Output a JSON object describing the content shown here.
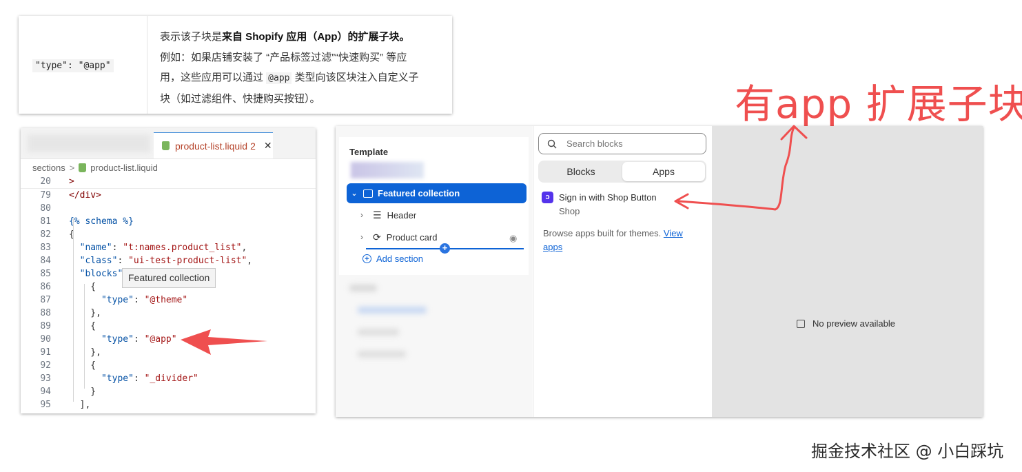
{
  "doc_table": {
    "code": "\"type\": \"@app\"",
    "desc_prefix": "表示该子块是",
    "desc_bold": "来自 Shopify 应用（App）的扩展子块",
    "desc_end": "。",
    "line2_a": "例如：如果店铺安装了 “产品标签过滤”“快速购买” 等应",
    "line3_a": "用，这些应用可以通过 ",
    "line3_code": "@app",
    "line3_b": " 类型向该区块注入自定义子",
    "line4": "块（如过滤组件、快捷购买按钮）。"
  },
  "annotation_label": "有app 扩展子块",
  "vscode": {
    "tab_file": "product-list.liquid",
    "tab_count": "2",
    "tab_close": "✕",
    "breadcrumb_folder": "sections",
    "breadcrumb_sep": ">",
    "breadcrumb_file": "product-list.liquid",
    "tooltip": "Featured collection",
    "lines": [
      {
        "n": "20",
        "t": ">"
      },
      {
        "n": "79",
        "t": "</div>"
      },
      {
        "n": "80",
        "t": ""
      },
      {
        "n": "81",
        "t": "{% schema %}"
      },
      {
        "n": "82",
        "t": "{"
      },
      {
        "n": "83",
        "k": "\"name\"",
        "v": "\"t:names.product_list\"",
        "i": "  ",
        "e": ","
      },
      {
        "n": "84",
        "k": "\"class\"",
        "v": "\"ui-test-product-list\"",
        "i": "  ",
        "e": ","
      },
      {
        "n": "85",
        "k": "\"blocks\"",
        "v": "[",
        "i": "  ",
        "e": ""
      },
      {
        "n": "86",
        "t": "    {"
      },
      {
        "n": "87",
        "k": "\"type\"",
        "v": "\"@theme\"",
        "i": "      ",
        "e": ""
      },
      {
        "n": "88",
        "t": "    },"
      },
      {
        "n": "89",
        "t": "    {"
      },
      {
        "n": "90",
        "k": "\"type\"",
        "v": "\"@app\"",
        "i": "      ",
        "e": ""
      },
      {
        "n": "91",
        "t": "    },"
      },
      {
        "n": "92",
        "t": "    {"
      },
      {
        "n": "93",
        "k": "\"type\"",
        "v": "\"_divider\"",
        "i": "      ",
        "e": ""
      },
      {
        "n": "94",
        "t": "    }"
      },
      {
        "n": "95",
        "t": "  ],"
      }
    ]
  },
  "shopify": {
    "template_title": "Template",
    "featured_collection": "Featured collection",
    "header": "Header",
    "product_card": "Product card",
    "add_section": "Add section",
    "search_placeholder": "Search blocks",
    "tab_blocks": "Blocks",
    "tab_apps": "Apps",
    "app_name": "Sign in with Shop Button",
    "app_vendor": "Shop",
    "browse_text": "Browse apps built for themes.",
    "view_apps": "View apps",
    "no_preview": "No preview available"
  },
  "watermark": "掘金技术社区 @ 小白踩坑",
  "colors": {
    "annotation_red": "#ef4f4f",
    "shopify_blue": "#0d63d6",
    "shop_purple": "#5433eb"
  }
}
